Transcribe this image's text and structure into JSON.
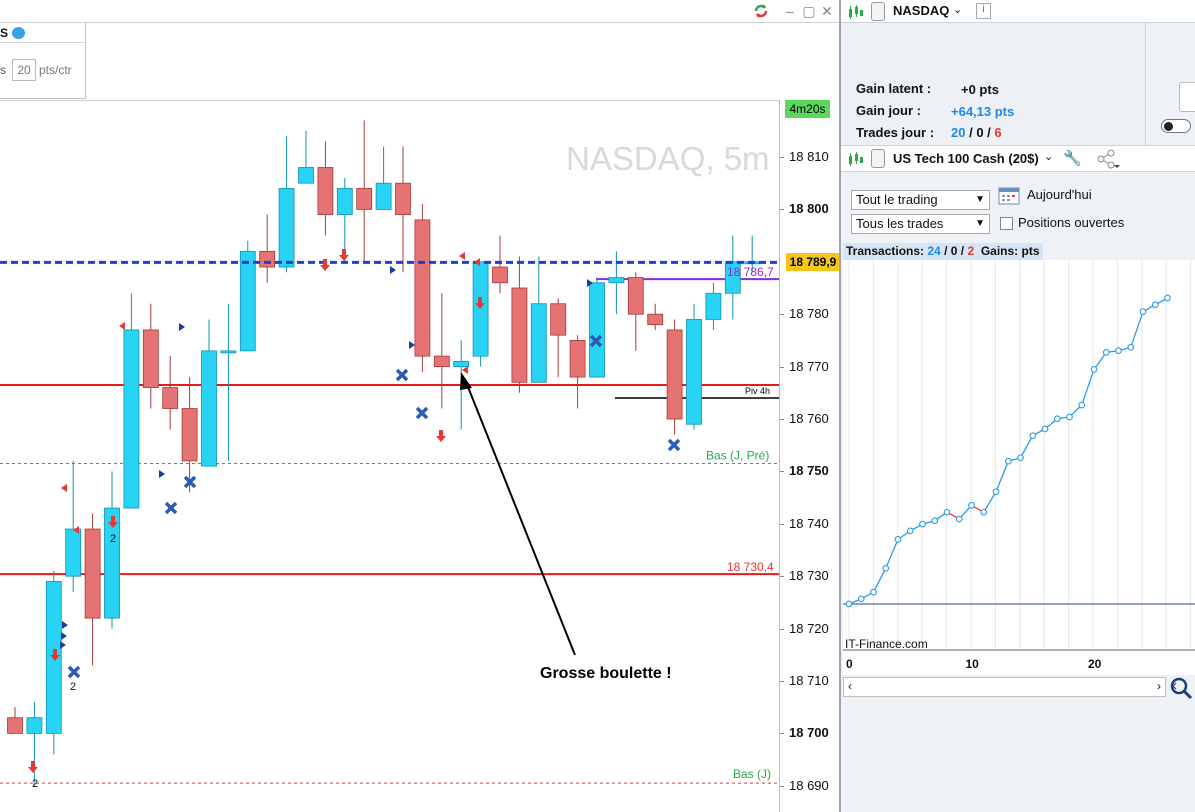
{
  "chart_window": {
    "order_panel": {
      "title_fragment": "S",
      "pts_prefix": "s",
      "pts_value": "20",
      "pts_suffix": "pts/ctr"
    },
    "timer": "4m20s",
    "watermark": "NASDAQ, 5m",
    "annotation": "Grosse boulette !",
    "axis_labels": [
      {
        "price": 18810,
        "label": "18 810",
        "bold": false
      },
      {
        "price": 18800,
        "label": "18 800",
        "bold": true
      },
      {
        "price": 18780,
        "label": "18 780",
        "bold": false
      },
      {
        "price": 18770,
        "label": "18 770",
        "bold": false
      },
      {
        "price": 18760,
        "label": "18 760",
        "bold": false
      },
      {
        "price": 18750,
        "label": "18 750",
        "bold": true
      },
      {
        "price": 18740,
        "label": "18 740",
        "bold": false
      },
      {
        "price": 18730,
        "label": "18 730",
        "bold": false
      },
      {
        "price": 18720,
        "label": "18 720",
        "bold": false
      },
      {
        "price": 18710,
        "label": "18 710",
        "bold": false
      },
      {
        "price": 18700,
        "label": "18 700",
        "bold": true
      },
      {
        "price": 18690,
        "label": "18 690",
        "bold": false
      }
    ],
    "current_price_tag": "18 789,9",
    "level_labels": {
      "purple": "18 786,7",
      "piv": "Piv 4h",
      "bas_jpre": "Bas (J, Pré)",
      "red_level": "18 730,4",
      "bas_j": "Bas (J)"
    },
    "count_labels": [
      "2",
      "2",
      "2"
    ],
    "colors": {
      "up": "#29d3f3",
      "down": "#e57373",
      "dashed_blue": "#1f3fcf",
      "red_line": "#e41b1b",
      "green": "#2ca84a",
      "purple": "#8a2be2"
    }
  },
  "chart_data": {
    "type": "candlestick",
    "symbol": "NASDAQ",
    "timeframe": "5m",
    "ylim": [
      18688,
      18830
    ],
    "candles": [
      {
        "o": 18703,
        "h": 18705,
        "l": 18700,
        "c": 18700
      },
      {
        "o": 18700,
        "h": 18706,
        "l": 18690,
        "c": 18703
      },
      {
        "o": 18700,
        "h": 18731,
        "l": 18696,
        "c": 18729
      },
      {
        "o": 18730,
        "h": 18752,
        "l": 18727,
        "c": 18739
      },
      {
        "o": 18739,
        "h": 18742,
        "l": 18713,
        "c": 18722
      },
      {
        "o": 18722,
        "h": 18750,
        "l": 18720,
        "c": 18743
      },
      {
        "o": 18743,
        "h": 18784,
        "l": 18743,
        "c": 18777
      },
      {
        "o": 18777,
        "h": 18782,
        "l": 18762,
        "c": 18766
      },
      {
        "o": 18766,
        "h": 18772,
        "l": 18758,
        "c": 18762
      },
      {
        "o": 18762,
        "h": 18768,
        "l": 18746,
        "c": 18752
      },
      {
        "o": 18751,
        "h": 18779,
        "l": 18751,
        "c": 18773
      },
      {
        "o": 18773,
        "h": 18782,
        "l": 18752,
        "c": 18773
      },
      {
        "o": 18773,
        "h": 18794,
        "l": 18773,
        "c": 18792
      },
      {
        "o": 18792,
        "h": 18799,
        "l": 18786,
        "c": 18789
      },
      {
        "o": 18789,
        "h": 18814,
        "l": 18788,
        "c": 18804
      },
      {
        "o": 18805,
        "h": 18815,
        "l": 18805,
        "c": 18808
      },
      {
        "o": 18808,
        "h": 18813,
        "l": 18795,
        "c": 18799
      },
      {
        "o": 18799,
        "h": 18806,
        "l": 18790,
        "c": 18804
      },
      {
        "o": 18804,
        "h": 18817,
        "l": 18790,
        "c": 18800
      },
      {
        "o": 18800,
        "h": 18812,
        "l": 18801,
        "c": 18805
      },
      {
        "o": 18805,
        "h": 18812,
        "l": 18788,
        "c": 18799
      },
      {
        "o": 18798,
        "h": 18801,
        "l": 18769,
        "c": 18772
      },
      {
        "o": 18772,
        "h": 18784,
        "l": 18762,
        "c": 18770
      },
      {
        "o": 18770,
        "h": 18775,
        "l": 18758,
        "c": 18771
      },
      {
        "o": 18772,
        "h": 18789,
        "l": 18770,
        "c": 18790
      },
      {
        "o": 18789,
        "h": 18795,
        "l": 18784,
        "c": 18786
      },
      {
        "o": 18785,
        "h": 18791,
        "l": 18765,
        "c": 18767
      },
      {
        "o": 18767,
        "h": 18791,
        "l": 18767,
        "c": 18782
      },
      {
        "o": 18782,
        "h": 18783,
        "l": 18768,
        "c": 18776
      },
      {
        "o": 18775,
        "h": 18776,
        "l": 18762,
        "c": 18768
      },
      {
        "o": 18768,
        "h": 18787,
        "l": 18768,
        "c": 18786
      },
      {
        "o": 18786,
        "h": 18792,
        "l": 18780,
        "c": 18787
      },
      {
        "o": 18787,
        "h": 18788,
        "l": 18773,
        "c": 18780
      },
      {
        "o": 18780,
        "h": 18782,
        "l": 18777,
        "c": 18778
      },
      {
        "o": 18777,
        "h": 18779,
        "l": 18757,
        "c": 18760
      },
      {
        "o": 18759,
        "h": 18782,
        "l": 18758,
        "c": 18779
      },
      {
        "o": 18779,
        "h": 18786,
        "l": 18777,
        "c": 18784
      },
      {
        "o": 18784,
        "h": 18795,
        "l": 18779,
        "c": 18790
      },
      {
        "o": 18790,
        "h": 18795,
        "l": 18788,
        "c": 18790
      }
    ],
    "levels": [
      {
        "name": "current",
        "price": 18789.9
      },
      {
        "name": "purple",
        "price": 18786.7
      },
      {
        "name": "red_upper",
        "price": 18766.5
      },
      {
        "name": "piv_4h",
        "price": 18764
      },
      {
        "name": "bas_j_pre",
        "price": 18751.5
      },
      {
        "name": "red_level",
        "price": 18730.4
      },
      {
        "name": "bas_j",
        "price": 18690.5
      }
    ]
  },
  "right_panel": {
    "instrument": "NASDAQ",
    "gains": [
      {
        "label": "Gain latent :",
        "value": "+0 pts",
        "color": "#111111"
      },
      {
        "label": "Gain jour :",
        "value": "+64,13 pts",
        "color": "#1e88e5"
      },
      {
        "label": "Trades jour :",
        "v1": "20",
        "v2": "0",
        "v3": "6",
        "sep": " / "
      }
    ],
    "product": "US Tech 100 Cash (20$)",
    "filter1": "Tout le trading",
    "filter2": "Tous les trades",
    "period": "Aujourd'hui",
    "open_positions": "Positions ouvertes",
    "stats": {
      "prefix": "Transactions:",
      "v1": "24",
      "v2": "0",
      "v3": "2",
      "gains": "Gains:",
      "unit": "pts"
    },
    "watermark": "IT-Finance.com",
    "x_ticks": [
      "0",
      "10",
      "20"
    ]
  },
  "equity_curve": {
    "type": "line",
    "x": [
      0,
      1,
      2,
      3,
      4,
      5,
      6,
      7,
      8,
      9,
      10,
      11,
      12,
      13,
      14,
      15,
      16,
      17,
      18,
      19,
      20,
      21,
      22,
      23,
      24,
      25,
      26
    ],
    "y": [
      0,
      1.5,
      3.5,
      10.5,
      19,
      21.5,
      23.5,
      24.5,
      27,
      25,
      29,
      27,
      33,
      42,
      43,
      49.5,
      51.5,
      54.5,
      55,
      58.5,
      69,
      74,
      74.5,
      75.5,
      86,
      88,
      90
    ]
  }
}
